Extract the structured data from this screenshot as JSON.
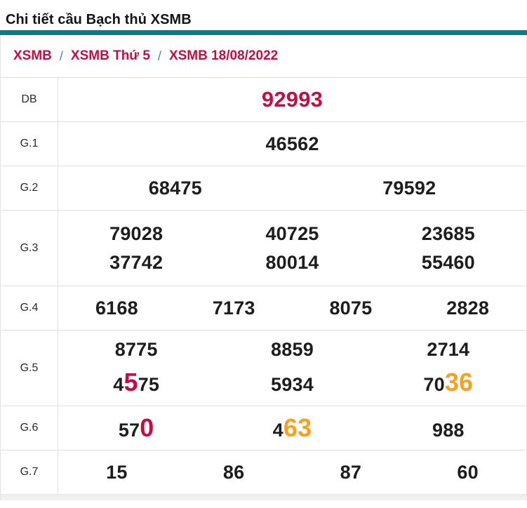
{
  "page": {
    "title": "Chi tiết cầu Bạch thủ XSMB"
  },
  "colors": {
    "accent_teal": "#077e85",
    "crimson": "#c60c44",
    "orange": "#f9a11d",
    "number_black": "#1d1d1d",
    "border_gray": "#e0e0e0"
  },
  "breadcrumb": {
    "separator": "/",
    "items": [
      "XSMB",
      "XSMB Thứ 5",
      "XSMB 18/08/2022"
    ]
  },
  "table": {
    "rows": [
      {
        "label": "DB",
        "size": "lg",
        "lines": [
          [
            [
              {
                "t": "92993",
                "c": "red"
              }
            ]
          ]
        ]
      },
      {
        "label": "G.1",
        "lines": [
          [
            [
              {
                "t": "46562"
              }
            ]
          ]
        ]
      },
      {
        "label": "G.2",
        "lines": [
          [
            [
              {
                "t": "68475"
              }
            ],
            [
              {
                "t": "79592"
              }
            ]
          ]
        ]
      },
      {
        "label": "G.3",
        "lines": [
          [
            [
              {
                "t": "79028"
              }
            ],
            [
              {
                "t": "40725"
              }
            ],
            [
              {
                "t": "23685"
              }
            ]
          ],
          [
            [
              {
                "t": "37742"
              }
            ],
            [
              {
                "t": "80014"
              }
            ],
            [
              {
                "t": "55460"
              }
            ]
          ]
        ]
      },
      {
        "label": "G.4",
        "lines": [
          [
            [
              {
                "t": "6168"
              }
            ],
            [
              {
                "t": "7173"
              }
            ],
            [
              {
                "t": "8075"
              }
            ],
            [
              {
                "t": "2828"
              }
            ]
          ]
        ]
      },
      {
        "label": "G.5",
        "lines": [
          [
            [
              {
                "t": "8775"
              }
            ],
            [
              {
                "t": "8859"
              }
            ],
            [
              {
                "t": "2714"
              }
            ]
          ],
          [
            [
              {
                "t": "4"
              },
              {
                "t": "5",
                "c": "red",
                "big": true
              },
              {
                "t": "75"
              }
            ],
            [
              {
                "t": "5934"
              }
            ],
            [
              {
                "t": "70"
              },
              {
                "t": "36",
                "c": "orange",
                "big": true
              }
            ]
          ]
        ]
      },
      {
        "label": "G.6",
        "lines": [
          [
            [
              {
                "t": "57"
              },
              {
                "t": "0",
                "c": "red",
                "big": true
              }
            ],
            [
              {
                "t": "4"
              },
              {
                "t": "63",
                "c": "orange",
                "big": true
              }
            ],
            [
              {
                "t": "988"
              }
            ]
          ]
        ]
      },
      {
        "label": "G.7",
        "lines": [
          [
            [
              {
                "t": "15"
              }
            ],
            [
              {
                "t": "86"
              }
            ],
            [
              {
                "t": "87"
              }
            ],
            [
              {
                "t": "60"
              }
            ]
          ]
        ]
      }
    ]
  }
}
